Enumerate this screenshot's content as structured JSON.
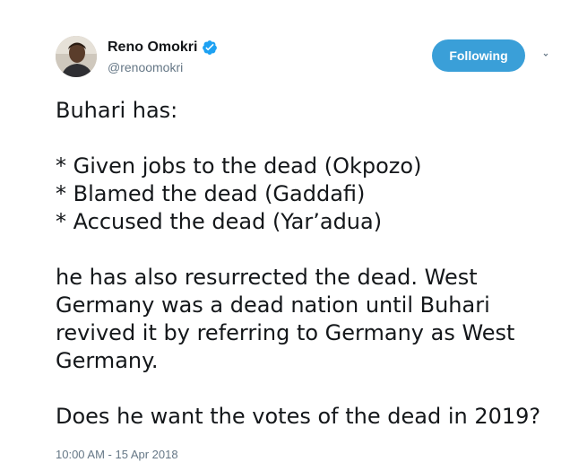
{
  "author": {
    "name": "Reno Omokri",
    "handle": "@renoomokri",
    "verified": true,
    "verified_color": "#1da1f2"
  },
  "follow_button": {
    "label": "Following",
    "color": "#3a9fd8"
  },
  "tweet": {
    "line1": "Buhari has:",
    "bullet1": "* Given jobs to the dead (Okpozo)",
    "bullet2": "* Blamed the dead (Gaddafi)",
    "bullet3": "* Accused the dead (Yar’adua)",
    "para2": "he has also resurrected the dead. West Germany was a dead nation until Buhari revived it by referring to Germany as West Germany.",
    "para3": "Does he want the votes of the dead in 2019?"
  },
  "timestamp": "10:00 AM - 15 Apr 2018",
  "icons": {
    "verified": "verified-badge-icon",
    "caret": "chevron-down-icon"
  }
}
